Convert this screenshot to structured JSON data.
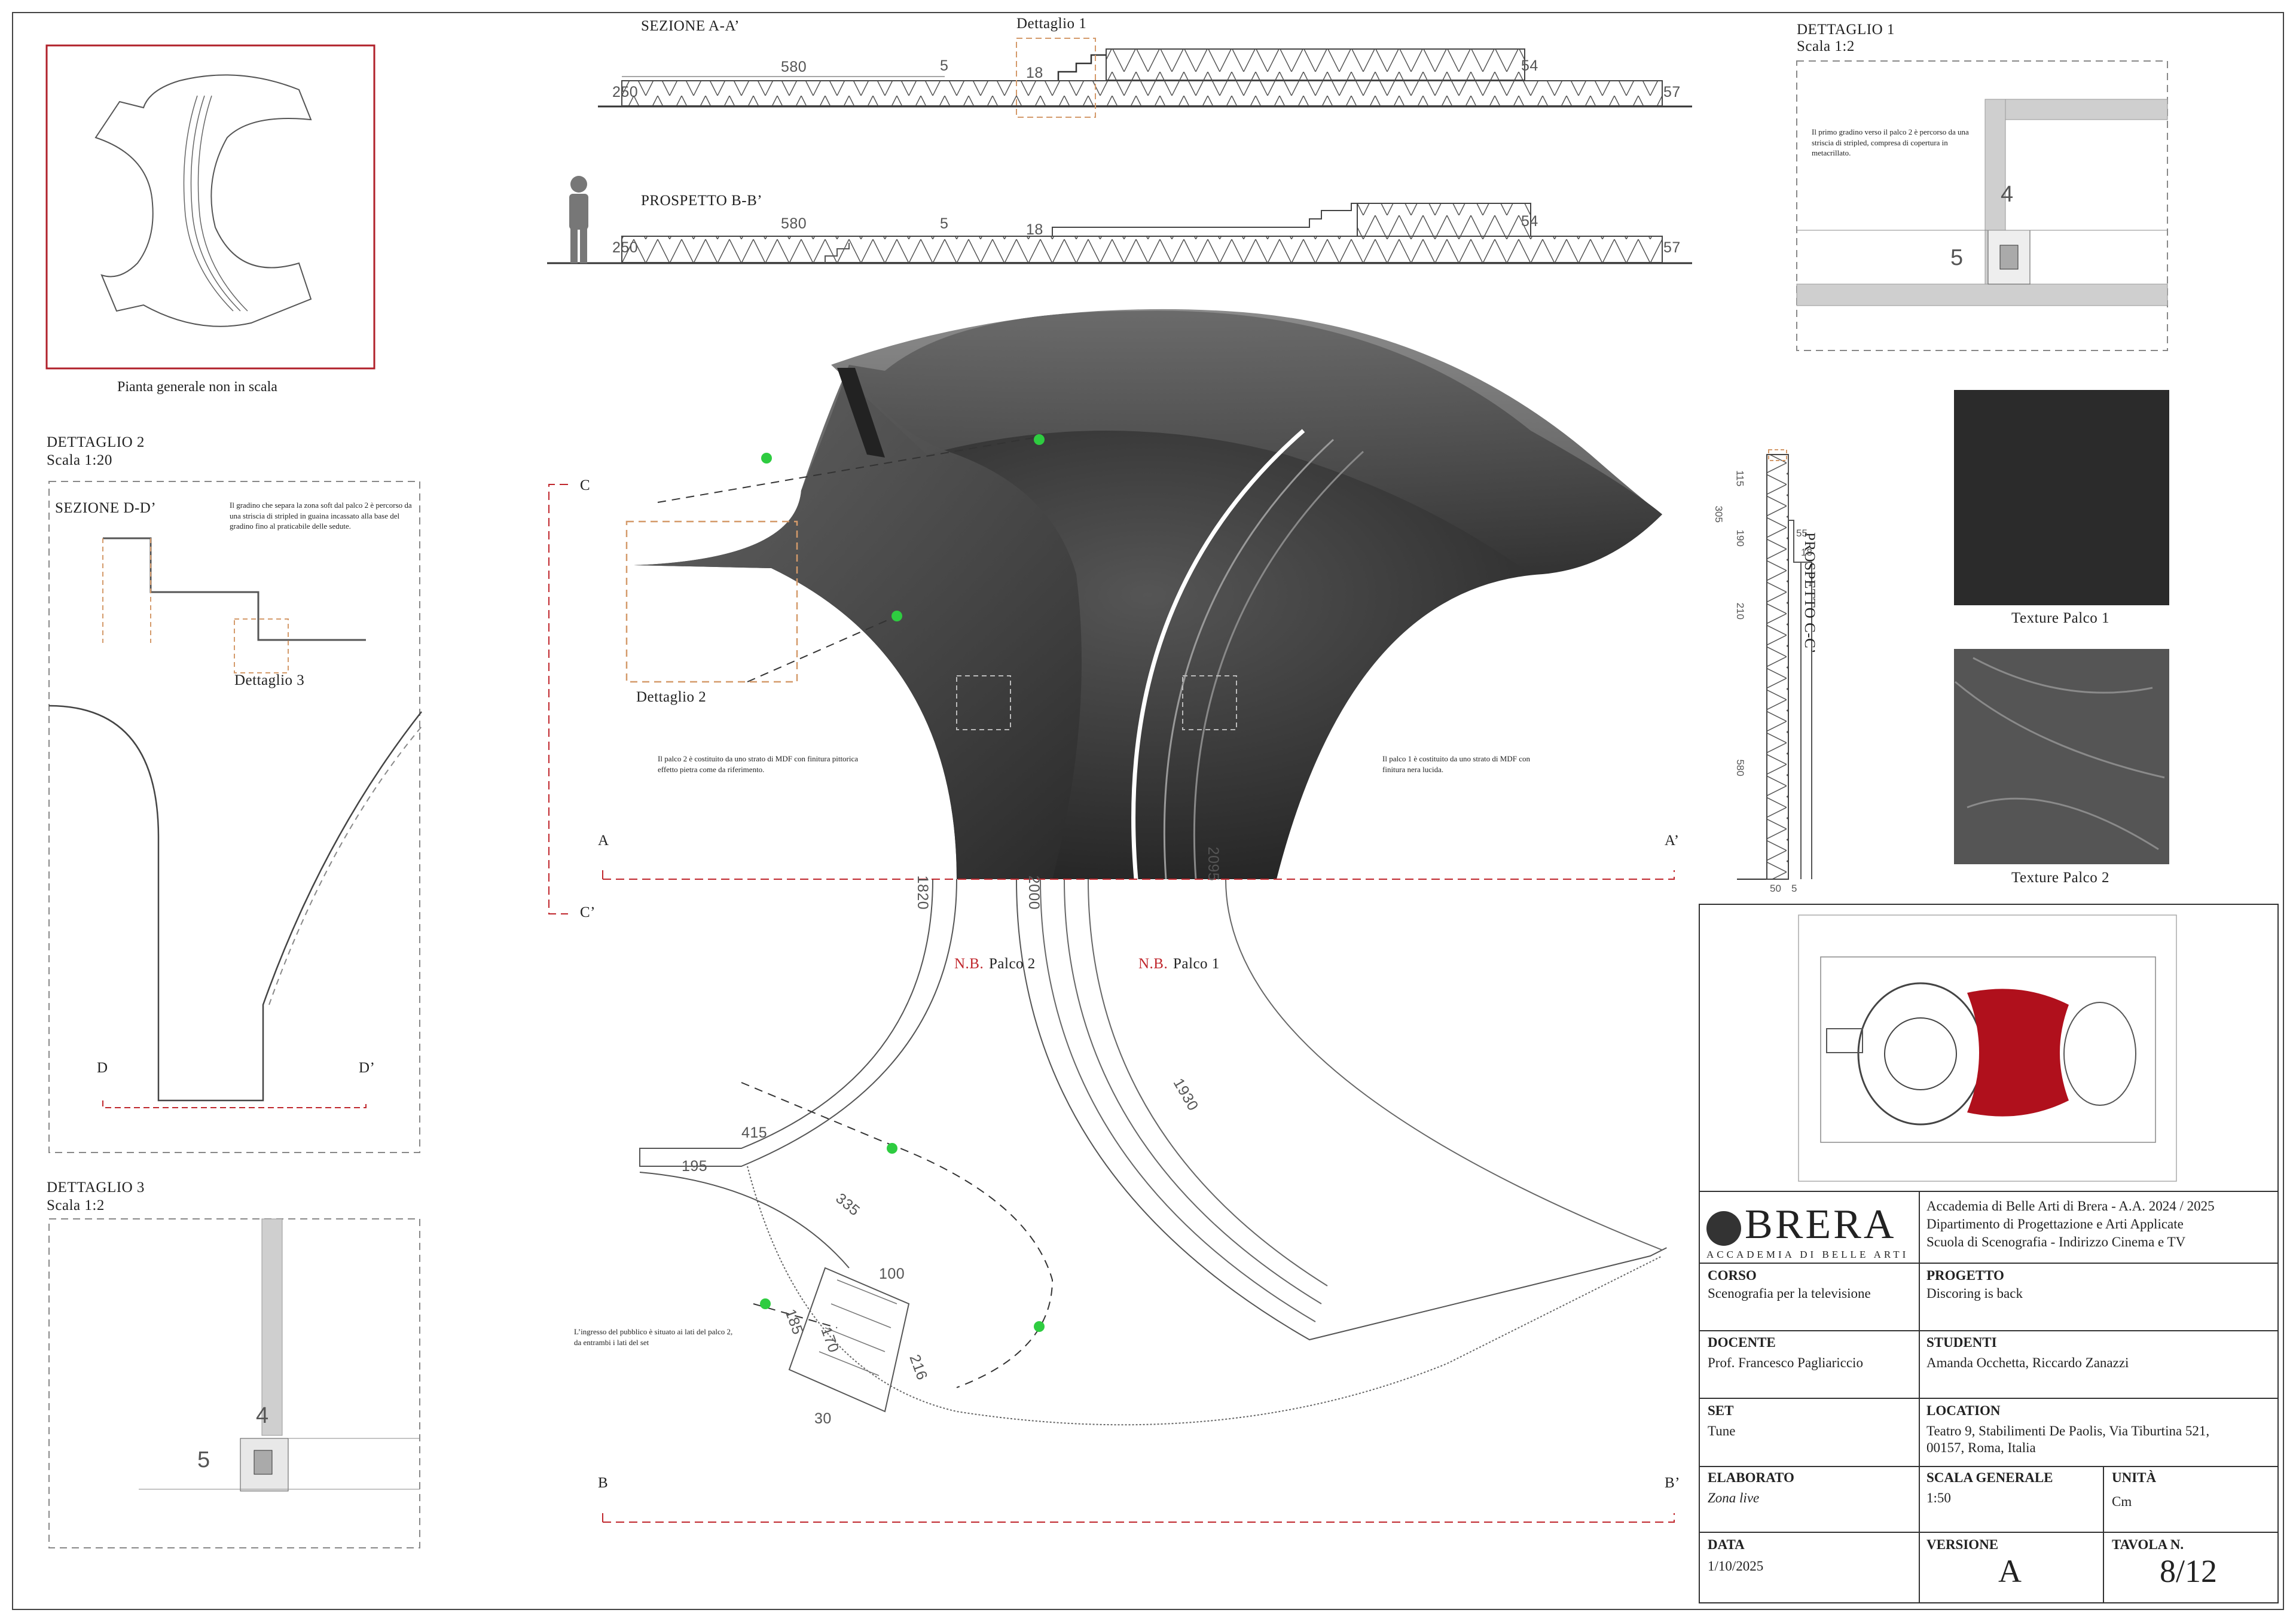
{
  "sheet": {
    "overview_caption": "Pianta generale non in scala",
    "section_aa": {
      "title": "SEZIONE A-A’",
      "detail_label": "Dettaglio 1",
      "dims": [
        "580",
        "5",
        "18",
        "54",
        "250",
        "57"
      ]
    },
    "elevation_bb": {
      "title": "PROSPETTO B-B’",
      "dims": [
        "580",
        "5",
        "18",
        "54",
        "250",
        "57"
      ]
    },
    "detail1": {
      "title": "DETTAGLIO 1",
      "scale": "Scala 1:2",
      "note": "Il primo gradino verso il palco 2 è percorso da una striscia di stripled, compresa di copertura in metacrillato.",
      "dims": [
        "4",
        "5"
      ]
    },
    "detail2": {
      "title": "DETTAGLIO 2",
      "scale": "Scala 1:20",
      "section_title": "SEZIONE D-D’",
      "note": "Il gradino che separa la zona soft dal palco 2 è percorso da una striscia di stripled in guaina incassato alla base del gradino fino al praticabile delle sedute.",
      "sub_label": "Dettaglio 3",
      "cut_left": "D",
      "cut_right": "D’"
    },
    "detail3": {
      "title": "DETTAGLIO 3",
      "scale": "Scala 1:2",
      "dims": [
        "4",
        "5"
      ]
    },
    "plan": {
      "cut_a": "A",
      "cut_a2": "A’",
      "cut_b": "B",
      "cut_b2": "B’",
      "cut_c": "C",
      "cut_c2": "C’",
      "detail2_label": "Dettaglio 2",
      "note_palco2": "Il palco 2 è costituito da uno strato di MDF con finitura pittorica effetto pietra come da riferimento.",
      "note_palco1": "Il palco 1 è costituito da uno strato di MDF con finitura nera lucida.",
      "nb": "N.B.",
      "palco2": "Palco 2",
      "palco1": "Palco 1",
      "entrance_note": "L’ingresso del pubblico è situato ai lati del palco 2, da entrambi i lati del set",
      "dims": [
        "1820",
        "2000",
        "2095",
        "1930",
        "415",
        "195",
        "335",
        "100",
        "185",
        "170",
        "216",
        "30"
      ]
    },
    "elevation_cc": {
      "title": "PROSPETTO C-C’",
      "dims": [
        "115",
        "305",
        "190",
        "55",
        "18",
        "210",
        "580",
        "50",
        "5"
      ]
    },
    "textures": [
      {
        "label": "Texture Palco 1",
        "color": "#2b2b2b"
      },
      {
        "label": "Texture Palco 2",
        "color": "#555555"
      }
    ]
  },
  "titleblock": {
    "logo": "BRERA",
    "logo_sub": "ACCADEMIA DI BELLE ARTI",
    "institution": [
      "Accademia di Belle Arti di Brera - A.A. 2024 / 2025",
      "Dipartimento di Progettazione e Arti Applicate",
      "Scuola di Scenografia - Indirizzo Cinema e TV"
    ],
    "corso_label": "CORSO",
    "corso": "Scenografia per la televisione",
    "progetto_label": "PROGETTO",
    "progetto": "Discoring is back",
    "docente_label": "DOCENTE",
    "docente": "Prof. Francesco Pagliariccio",
    "studenti_label": "STUDENTI",
    "studenti": "Amanda Occhetta, Riccardo Zanazzi",
    "set_label": "SET",
    "set": "Tune",
    "location_label": "LOCATION",
    "location": [
      "Teatro 9, Stabilimenti De Paolis, Via Tiburtina 521,",
      "00157, Roma, Italia"
    ],
    "elaborato_label": "ELABORATO",
    "elaborato_main": "Zona ",
    "elaborato_italic": "live",
    "scala_label": "SCALA GENERALE",
    "scala": "1:50",
    "unita_label": "UNITÀ",
    "unita": "Cm",
    "data_label": "DATA",
    "data": "1/10/2025",
    "versione_label": "VERSIONE",
    "versione": "A",
    "tavola_label": "TAVOLA N.",
    "tavola": "8/12"
  },
  "colors": {
    "accent": "#c0272d",
    "dash_orange": "#d49a6a",
    "exit_green": "#2ecc40",
    "stage_red": "#b0101c"
  }
}
